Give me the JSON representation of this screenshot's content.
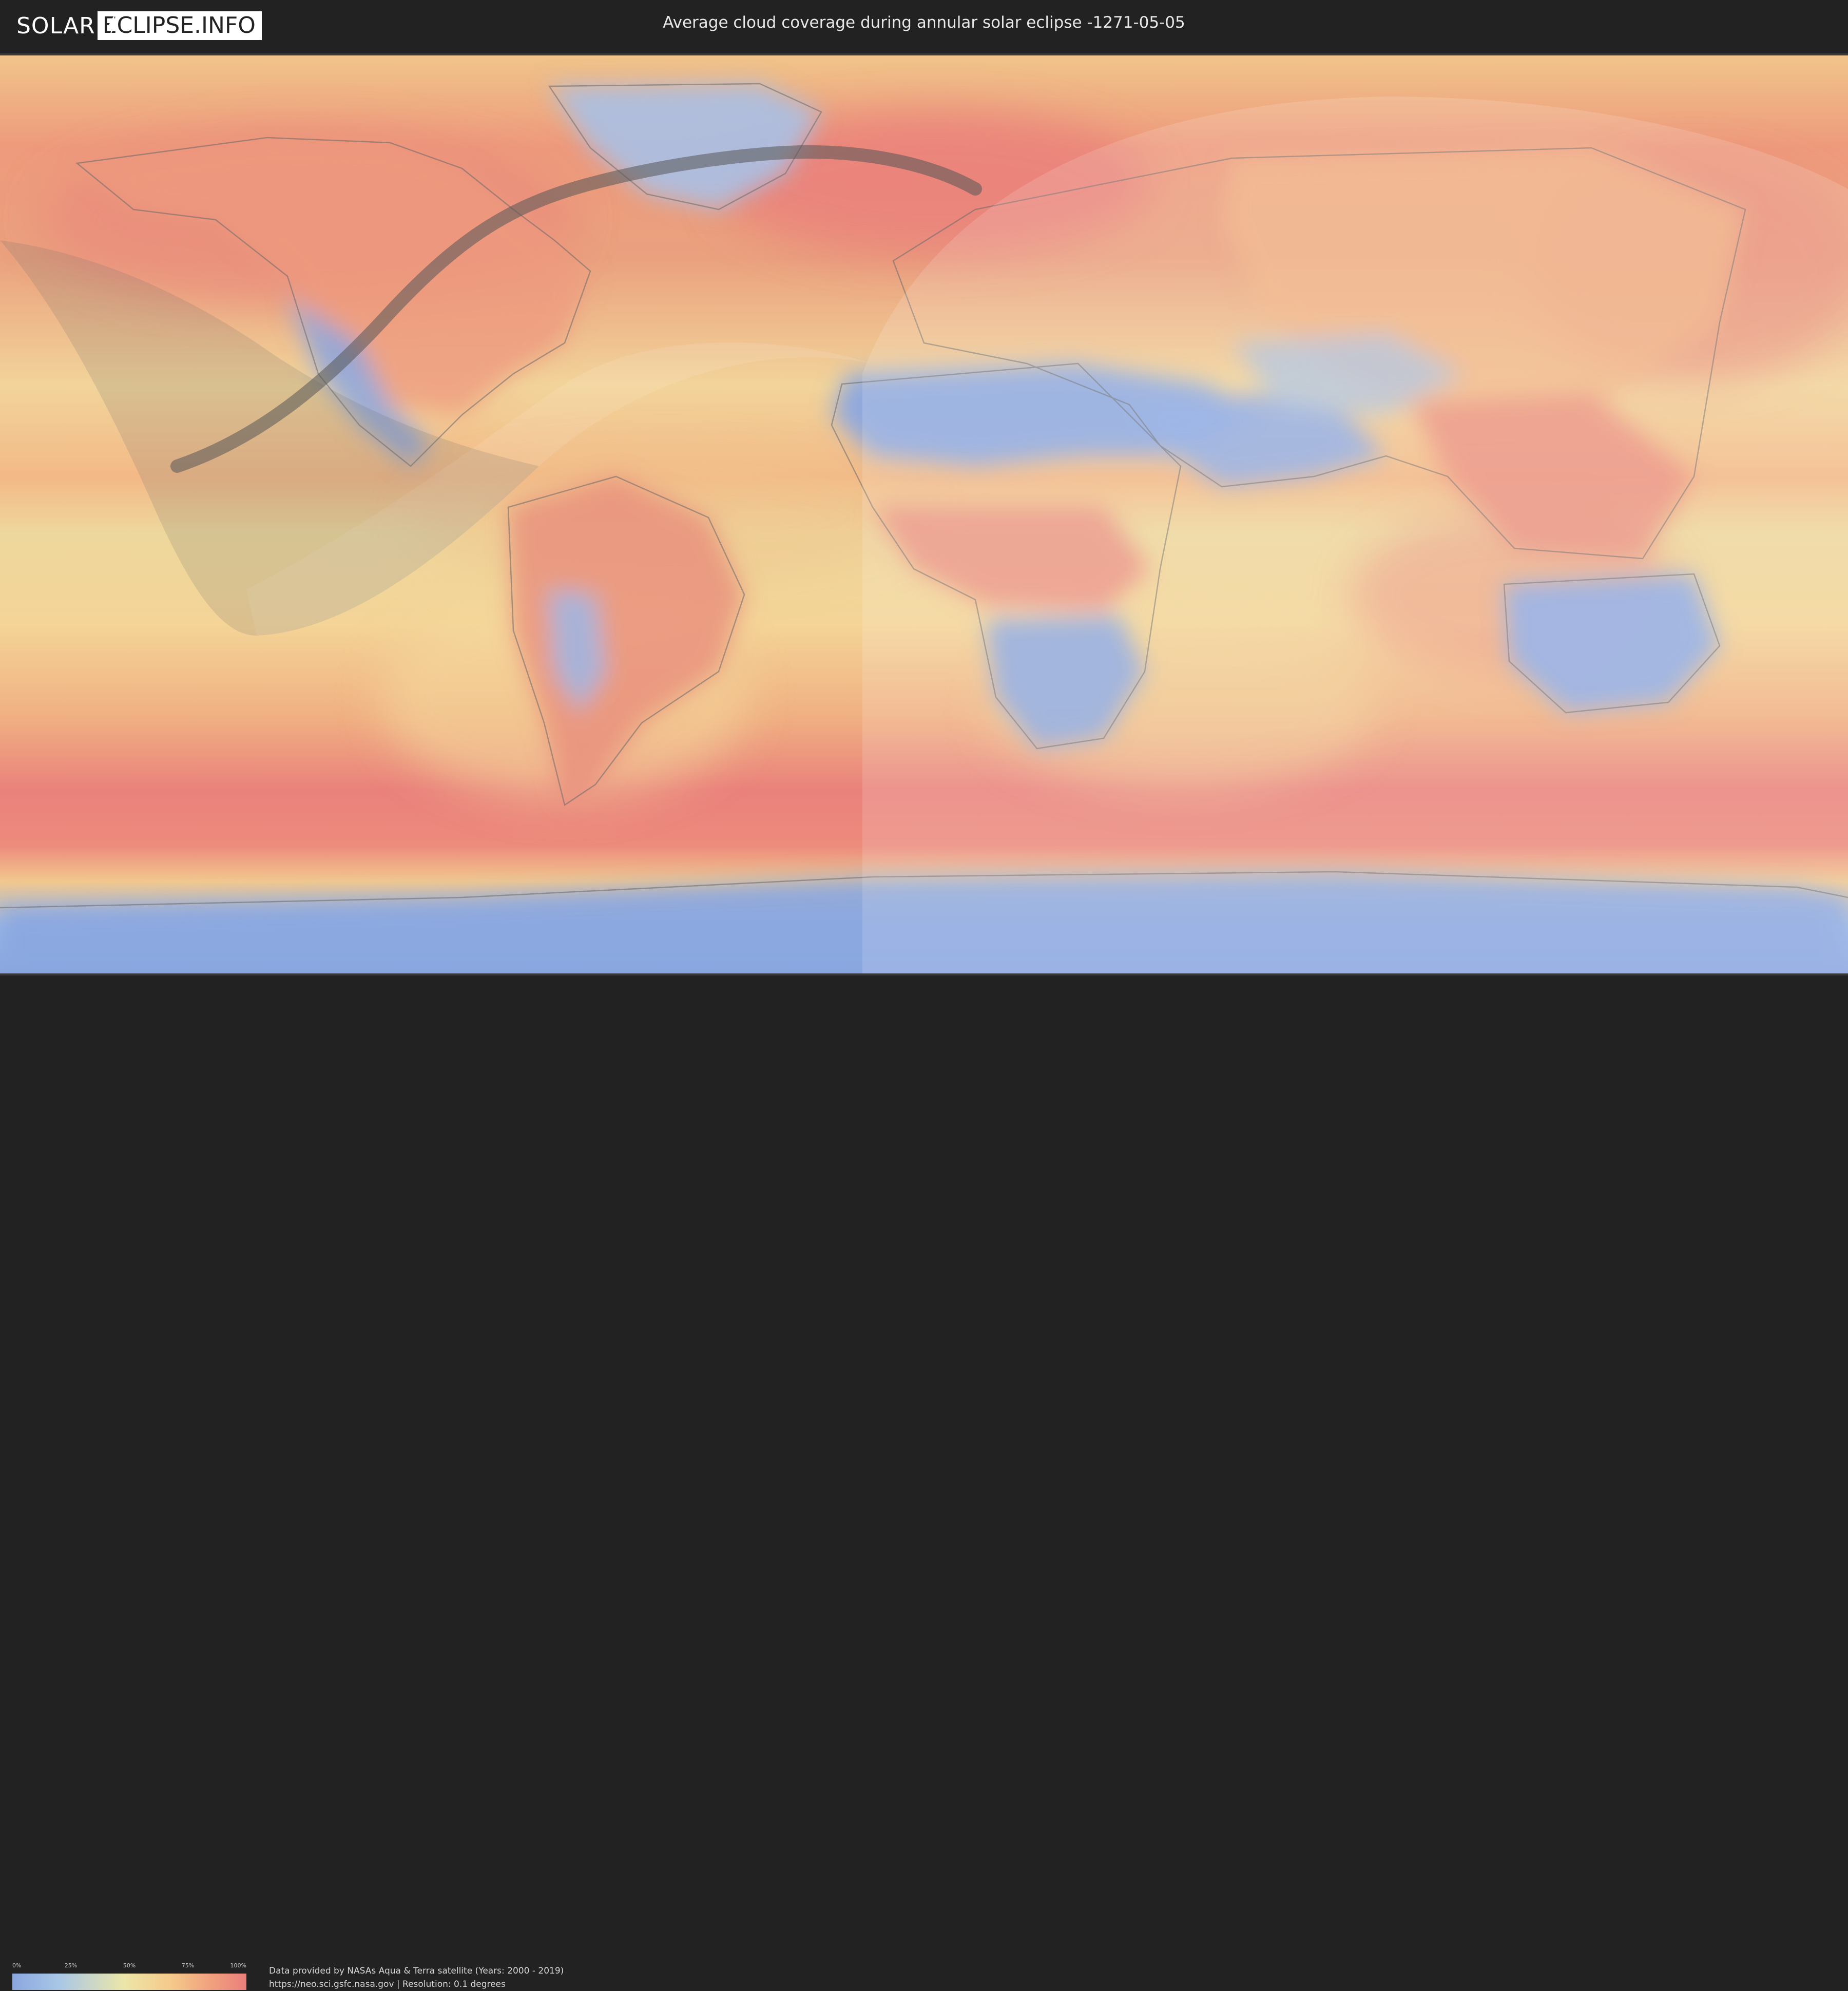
{
  "header": {
    "logo_left": "SOLAR",
    "logo_right": "ECLIPSE.INFO",
    "title": "Average cloud coverage during annular solar eclipse -1271-05-05"
  },
  "map": {
    "colors": {
      "clear": "#8aa6e0",
      "low": "#a9c7e6",
      "mid": "#ece6a8",
      "high": "#f5c98a",
      "cloudy": "#ea7f7c",
      "land_outline": "#6a6a6a",
      "eclipse_path": "#555555"
    }
  },
  "legend": {
    "ticks": [
      "0%",
      "25%",
      "50%",
      "75%",
      "100%"
    ],
    "tick_values": [
      0,
      25,
      50,
      75,
      100
    ]
  },
  "footer": {
    "credit_line1": "Data provided by NASAs Aqua & Terra satellite (Years: 2000 - 2019)",
    "credit_line2": "https://neo.sci.gsfc.nasa.gov | Resolution: 0.1 degrees"
  }
}
